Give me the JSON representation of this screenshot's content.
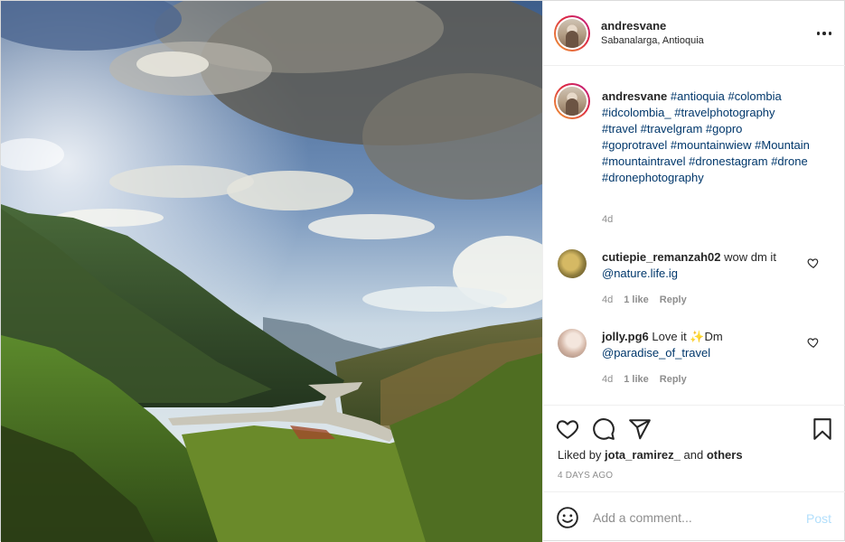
{
  "post": {
    "username": "andresvane",
    "location": "Sabanalarga, Antioquia",
    "caption": {
      "username": "andresvane",
      "hashtags": [
        "#antioquia",
        "#colombia",
        "#idcolombia_",
        "#travelphotography",
        "#travel",
        "#travelgram",
        "#gopro",
        "#goprotravel",
        "#mountainwiew",
        "#Mountain",
        "#mountaintravel",
        "#dronestagram",
        "#drone",
        "#dronephotography"
      ],
      "time": "4d"
    },
    "comments": [
      {
        "username": "cutiepie_remanzah02",
        "text": "wow dm it",
        "mention": "@nature.life.ig",
        "time": "4d",
        "likes": "1 like",
        "reply": "Reply"
      },
      {
        "username": "jolly.pg6",
        "text_before": "Love it",
        "emoji": "✨",
        "text_after": "Dm",
        "mention": "@paradise_of_travel",
        "time": "4d",
        "likes": "1 like",
        "reply": "Reply"
      }
    ],
    "liked_by": {
      "prefix": "Liked by",
      "user": "jota_ramirez_",
      "conj": "and",
      "others": "others"
    },
    "posted_ago": "4 DAYS AGO",
    "add_comment": {
      "placeholder": "Add a comment...",
      "post_label": "Post"
    }
  },
  "icons": {
    "more": "more-options-icon",
    "like": "heart-icon",
    "comment": "comment-icon",
    "share": "paper-plane-icon",
    "save": "bookmark-icon",
    "emoji": "smiley-icon"
  },
  "colors": {
    "hashtag": "#00376b",
    "muted": "#8e8e8e",
    "post_disabled": "#b2dffc"
  }
}
